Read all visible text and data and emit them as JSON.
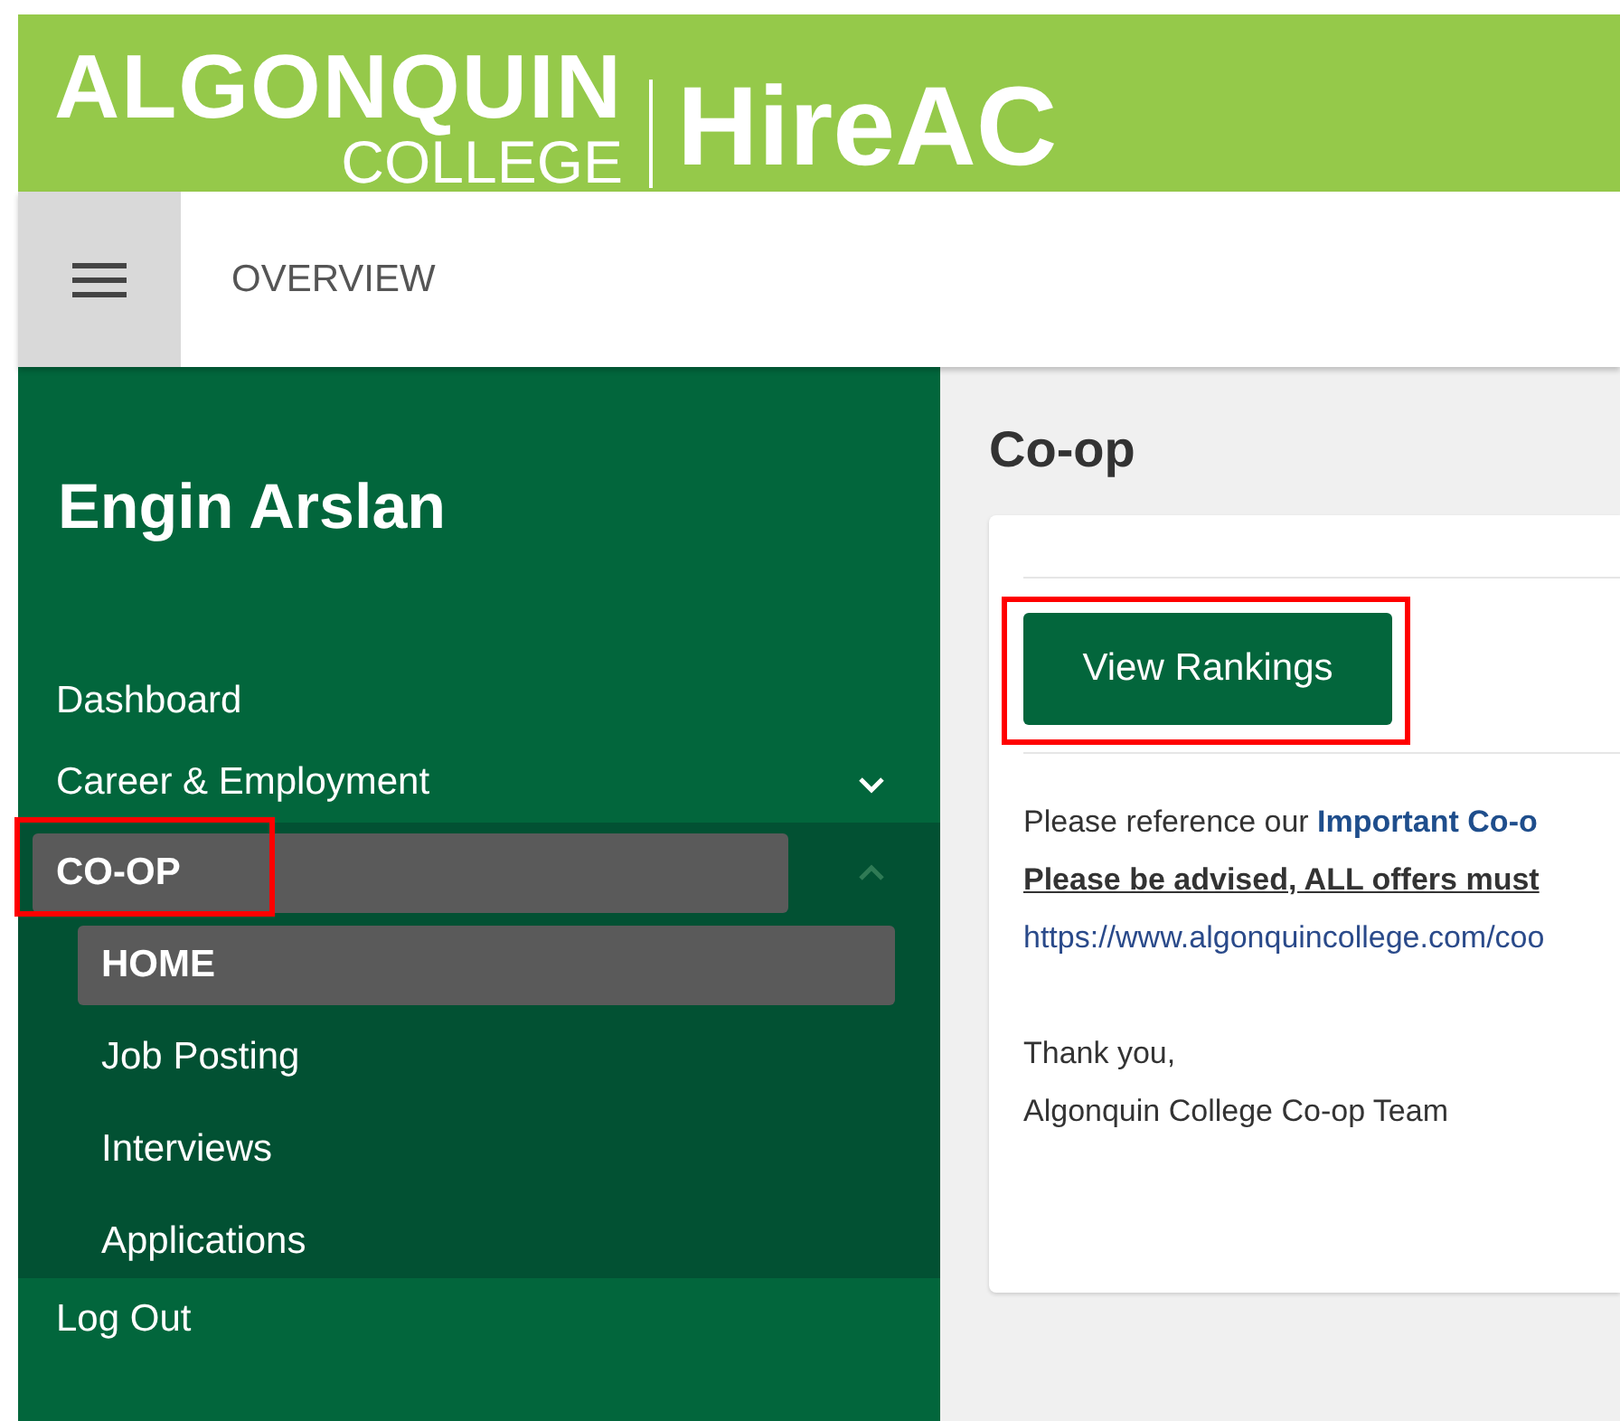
{
  "brand": {
    "logo_top": "ALGONQUIN",
    "logo_bottom": "COLLEGE",
    "app_name": "HireAC"
  },
  "header": {
    "title": "OVERVIEW"
  },
  "sidebar": {
    "user_name": "Engin Arslan",
    "items": [
      {
        "label": "Dashboard",
        "selected": false
      },
      {
        "label": "Career & Employment",
        "selected": false,
        "expanded": false
      },
      {
        "label": "CO-OP",
        "selected": true,
        "highlighted": true,
        "expanded": true,
        "children": [
          {
            "label": "HOME",
            "selected": true
          },
          {
            "label": "Job Posting",
            "selected": false
          },
          {
            "label": "Interviews",
            "selected": false
          },
          {
            "label": "Applications",
            "selected": false
          }
        ]
      },
      {
        "label": "Log Out",
        "selected": false
      }
    ]
  },
  "main": {
    "title": "Co-op",
    "button": {
      "label": "View Rankings",
      "highlighted": true
    },
    "message": [
      {
        "kind": "text",
        "text": "Please reference our **Important Co-o**"
      },
      {
        "kind": "bold_underline",
        "text": "Please be advised, ALL offers must"
      },
      {
        "kind": "link",
        "text": "https://www.algonquincollege.com/coo"
      },
      {
        "kind": "gap"
      },
      {
        "kind": "text",
        "text": "Thank you,"
      },
      {
        "kind": "text",
        "text": "Algonquin College Co-op Team"
      }
    ]
  }
}
